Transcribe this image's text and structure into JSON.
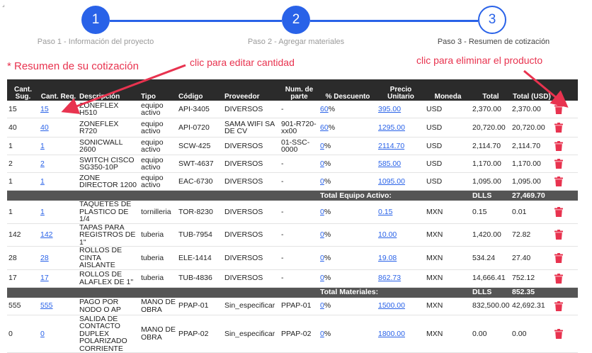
{
  "corner_mark": "⌟",
  "stepper": {
    "steps": [
      {
        "number": "1",
        "label": "Paso 1 - Información del proyecto"
      },
      {
        "number": "2",
        "label": "Paso 2 - Agregar materiales"
      },
      {
        "number": "3",
        "label": "Paso 3 - Resumen de cotización"
      }
    ]
  },
  "summary_title": "* Resumen de su cotización",
  "annotations": {
    "edit_quantity": "clic para editar cantidad",
    "delete_product": "clic para eliminar el producto",
    "color": "#e8334f"
  },
  "colors": {
    "accent": "#2962e8",
    "header_bg": "#2b2b2b",
    "group_bg": "#555555",
    "delete": "#e8334f"
  },
  "table": {
    "headers": {
      "sug": "Cant. Sug.",
      "req": "Cant. Req.",
      "desc": "Descripción",
      "tipo": "Tipo",
      "codigo": "Código",
      "proveedor": "Proveedor",
      "parte": "Num. de parte",
      "descuento": "% Descuento",
      "precio": "Precio Unitario",
      "moneda": "Moneda",
      "total": "Total",
      "usd": "Total (USD)"
    },
    "group_equipo": [
      {
        "sug": "15",
        "req": "15",
        "desc": "ZONEFLEX H510",
        "tipo": "equipo activo",
        "codigo": "API-3405",
        "proveedor": "DIVERSOS",
        "parte": "-",
        "desc_pct": "60",
        "pct": "%",
        "precio": "395.00",
        "moneda": "USD",
        "total": "2,370.00",
        "usd": "2,370.00"
      },
      {
        "sug": "40",
        "req": "40",
        "desc": "ZONEFLEX R720",
        "tipo": "equipo activo",
        "codigo": "API-0720",
        "proveedor": "SAMA WIFI SA DE CV",
        "parte": "901-R720-xx00",
        "desc_pct": "60",
        "pct": "%",
        "precio": "1295.00",
        "moneda": "USD",
        "total": "20,720.00",
        "usd": "20,720.00"
      },
      {
        "sug": "1",
        "req": "1",
        "desc": "SONICWALL 2600",
        "tipo": "equipo activo",
        "codigo": "SCW-425",
        "proveedor": "DIVERSOS",
        "parte": "01-SSC-0000",
        "desc_pct": "0",
        "pct": "%",
        "precio": "2114.70",
        "moneda": "USD",
        "total": "2,114.70",
        "usd": "2,114.70"
      },
      {
        "sug": "2",
        "req": "2",
        "desc": "SWITCH CISCO SG350-10P",
        "tipo": "equipo activo",
        "codigo": "SWT-4637",
        "proveedor": "DIVERSOS",
        "parte": "-",
        "desc_pct": "0",
        "pct": "%",
        "precio": "585.00",
        "moneda": "USD",
        "total": "1,170.00",
        "usd": "1,170.00"
      },
      {
        "sug": "1",
        "req": "1",
        "desc": "ZONE DIRECTOR 1200",
        "tipo": "equipo activo",
        "codigo": "EAC-6730",
        "proveedor": "DIVERSOS",
        "parte": "-",
        "desc_pct": "0",
        "pct": "%",
        "precio": "1095.00",
        "moneda": "USD",
        "total": "1,095.00",
        "usd": "1,095.00"
      }
    ],
    "total_equipo": {
      "label": "Total Equipo Activo:",
      "currency": "DLLS",
      "value": "27,469.70"
    },
    "group_materiales": [
      {
        "sug": "1",
        "req": "1",
        "desc": "TAQUETES DE PLASTICO DE 1/4",
        "tipo": "tornilleria",
        "codigo": "TOR-8230",
        "proveedor": "DIVERSOS",
        "parte": "-",
        "desc_pct": "0",
        "pct": "%",
        "precio": "0.15",
        "moneda": "MXN",
        "total": "0.15",
        "usd": "0.01"
      },
      {
        "sug": "142",
        "req": "142",
        "desc": "TAPAS PARA REGISTROS DE 1\"",
        "tipo": "tuberia",
        "codigo": "TUB-7954",
        "proveedor": "DIVERSOS",
        "parte": "-",
        "desc_pct": "0",
        "pct": "%",
        "precio": "10.00",
        "moneda": "MXN",
        "total": "1,420.00",
        "usd": "72.82"
      },
      {
        "sug": "28",
        "req": "28",
        "desc": "ROLLOS DE CINTA AISLANTE",
        "tipo": "tuberia",
        "codigo": "ELE-1414",
        "proveedor": "DIVERSOS",
        "parte": "-",
        "desc_pct": "0",
        "pct": "%",
        "precio": "19.08",
        "moneda": "MXN",
        "total": "534.24",
        "usd": "27.40"
      },
      {
        "sug": "17",
        "req": "17",
        "desc": "ROLLOS DE ALAFLEX DE 1\"",
        "tipo": "tuberia",
        "codigo": "TUB-4836",
        "proveedor": "DIVERSOS",
        "parte": "-",
        "desc_pct": "0",
        "pct": "%",
        "precio": "862.73",
        "moneda": "MXN",
        "total": "14,666.41",
        "usd": "752.12"
      }
    ],
    "total_materiales": {
      "label": "Total Materiales:",
      "currency": "DLLS",
      "value": "852.35"
    },
    "group_mano_obra": [
      {
        "sug": "555",
        "req": "555",
        "desc": "PAGO POR NODO O AP",
        "tipo": "MANO DE OBRA",
        "codigo": "PPAP-01",
        "proveedor": "Sin_especificar",
        "parte": "PPAP-01",
        "desc_pct": "0",
        "pct": "%",
        "precio": "1500.00",
        "moneda": "MXN",
        "total": "832,500.00",
        "usd": "42,692.31"
      },
      {
        "sug": "0",
        "req": "0",
        "desc": "SALIDA DE CONTACTO DUPLEX POLARIZADO CORRIENTE",
        "tipo": "MANO DE OBRA",
        "codigo": "PPAP-02",
        "proveedor": "Sin_especificar",
        "parte": "PPAP-02",
        "desc_pct": "0",
        "pct": "%",
        "precio": "1800.00",
        "moneda": "MXN",
        "total": "0.00",
        "usd": "0.00"
      }
    ]
  }
}
